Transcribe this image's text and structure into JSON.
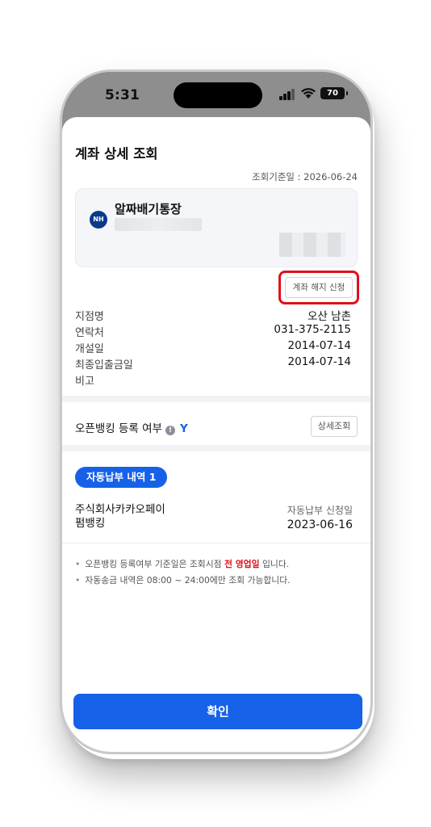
{
  "status_bar": {
    "time": "5:31",
    "battery": "70"
  },
  "page": {
    "title": "계좌 상세 조회",
    "ref_date": "조회기준일 : 2026-06-24"
  },
  "account": {
    "bank_logo": "NH",
    "name": "알짜배기통장"
  },
  "terminate_button": "계좌 해지 신청",
  "info": [
    {
      "label": "지점명",
      "value": "오산 남촌"
    },
    {
      "label": "연락처",
      "value": "031-375-2115"
    },
    {
      "label": "개설일",
      "value": "2014-07-14"
    },
    {
      "label": "최종입출금일",
      "value": "2014-07-14"
    },
    {
      "label": "비고",
      "value": ""
    }
  ],
  "open_banking": {
    "label": "오픈뱅킹 등록 여부",
    "value": "Y",
    "detail_button": "상세조회"
  },
  "autopay": {
    "tag": "자동납부 내역 1",
    "payee_line1": "주식회사카카오페이",
    "payee_line2": "펌뱅킹",
    "apply_label": "자동납부 신청일",
    "apply_date": "2023-06-16"
  },
  "notes": {
    "line1_pre": "오픈뱅킹 등록여부 기준일은 조회시점 ",
    "line1_highlight": "전 영업일",
    "line1_post": " 입니다.",
    "line2": "자동송금 내역은 08:00 ~ 24:00에만 조회 가능합니다."
  },
  "confirm_button": "확인",
  "colors": {
    "accent": "#1661e8",
    "highlight_red": "#e0101a",
    "nh_blue": "#0b3a8c"
  }
}
